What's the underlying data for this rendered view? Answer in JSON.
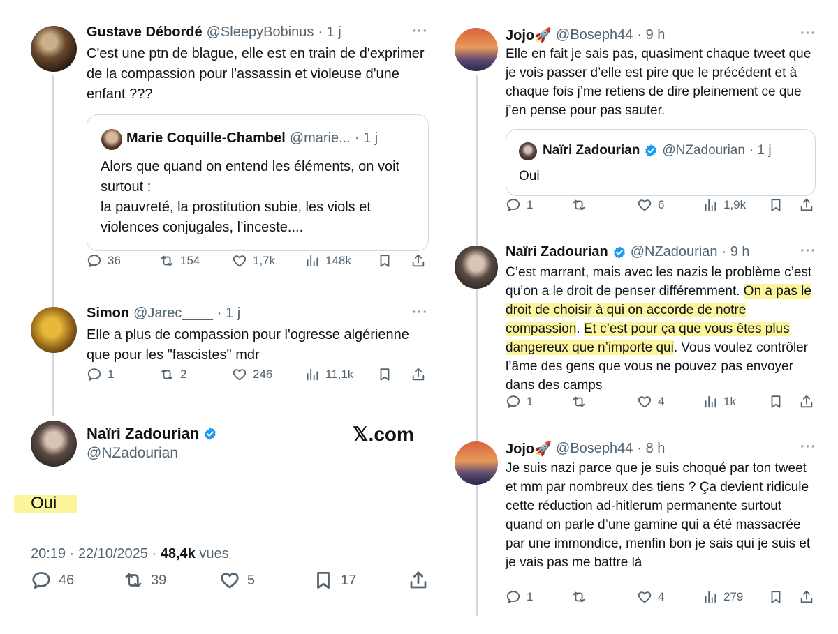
{
  "left": {
    "t1": {
      "name": "Gustave Débordé",
      "handle": "@SleepyBobinus",
      "time": "· 1 j",
      "text": "C'est une ptn de blague, elle est en train de d'exprimer de la compassion pour l'assassin et violeuse d'une enfant ???",
      "quote": {
        "name": "Marie Coquille-Chambel",
        "handle": "@marie...",
        "time": "· 1 j",
        "text_l1": "Alors que quand on entend les éléments, on voit surtout :",
        "text_l2": "la pauvreté, la prostitution subie, les viols et violences conjugales, l’inceste...."
      },
      "replies": "36",
      "reposts": "154",
      "likes": "1,7k",
      "views": "148k"
    },
    "t2": {
      "name": "Simon",
      "handle": "@Jarec____",
      "time": "· 1 j",
      "text": "Elle a plus de compassion pour l'ogresse algérienne que pour les \"fascistes\" mdr",
      "replies": "1",
      "reposts": "2",
      "likes": "246",
      "views": "11,1k"
    },
    "main": {
      "name": "Naïri Zadourian",
      "handle": "@NZadourian",
      "xcom": "𝕏.com",
      "text": "Oui",
      "timestamp": "20:19 · 22/10/2025 ·",
      "views_count": "48,4k",
      "views_label": "vues",
      "replies": "46",
      "reposts": "39",
      "likes": "5",
      "bookmarks": "17"
    }
  },
  "right": {
    "t1": {
      "name": "Jojo🚀",
      "handle": "@Boseph44",
      "time": "· 9 h",
      "text": "Elle en fait je sais pas, quasiment chaque tweet que je vois passer d’elle est pire que le précédent et à chaque fois j’me retiens de dire pleinement ce que j’en pense pour pas sauter.",
      "quote": {
        "name": "Naïri Zadourian",
        "handle": "@NZadourian",
        "time": "· 1 j",
        "text": "Oui"
      },
      "replies": "1",
      "reposts": "",
      "likes": "6",
      "views": "1,9k"
    },
    "t2": {
      "name": "Naïri Zadourian",
      "handle": "@NZadourian",
      "time": "· 9 h",
      "text_a": "C’est marrant, mais avec les nazis le problème c’est qu’on a le droit de penser différemment.",
      "text_hl1": "On a pas le droit de choisir à qui on accorde de notre compassion",
      "text_b": ".",
      "text_hl2": "Et c’est pour ça que vous êtes plus dangereux que n’importe qui",
      "text_c": ". Vous voulez contrôler l’âme des gens que vous ne pouvez pas envoyer dans des camps",
      "replies": "1",
      "reposts": "",
      "likes": "4",
      "views": "1k"
    },
    "t3": {
      "name": "Jojo🚀",
      "handle": "@Boseph44",
      "time": "· 8 h",
      "text": "Je suis nazi parce que je suis choqué par ton tweet et mm par nombreux des tiens ? Ça devient ridicule cette réduction ad-hitlerum permanente surtout quand on parle d’une gamine qui a été massacrée par une immondice, menfin bon je sais qui je suis et je vais pas me battre là",
      "replies": "1",
      "reposts": "",
      "likes": "4",
      "views": "279"
    }
  },
  "colors": {
    "accent": "#1d9bf0",
    "highlight": "#fdf59b",
    "muted": "#536471"
  }
}
